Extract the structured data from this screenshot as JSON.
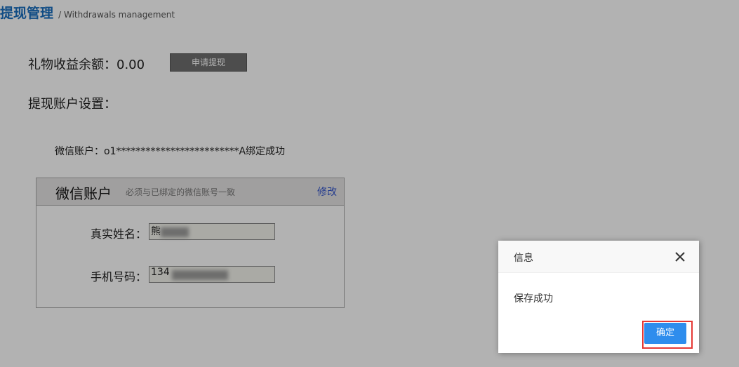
{
  "header": {
    "title": "提现管理",
    "subtitle": "/ Withdrawals management"
  },
  "balance": {
    "label": "礼物收益余额：0.00",
    "withdraw_button": "申请提现"
  },
  "settings_label": "提现账户设置：",
  "wechat_status": "微信账户：o1*************************A绑定成功",
  "panel": {
    "title": "微信账户",
    "note": "必须与已绑定的微信账号一致",
    "edit_link": "修改",
    "fields": {
      "name_label": "真实姓名：",
      "name_value": "熊",
      "phone_label": "手机号码：",
      "phone_value": "134"
    }
  },
  "dialog": {
    "title": "信息",
    "message": "保存成功",
    "ok_button": "确定",
    "close_icon": "close-icon"
  },
  "colors": {
    "brand": "#1a6fbf",
    "ok_button": "#2e8ded",
    "highlight": "#e53935"
  }
}
